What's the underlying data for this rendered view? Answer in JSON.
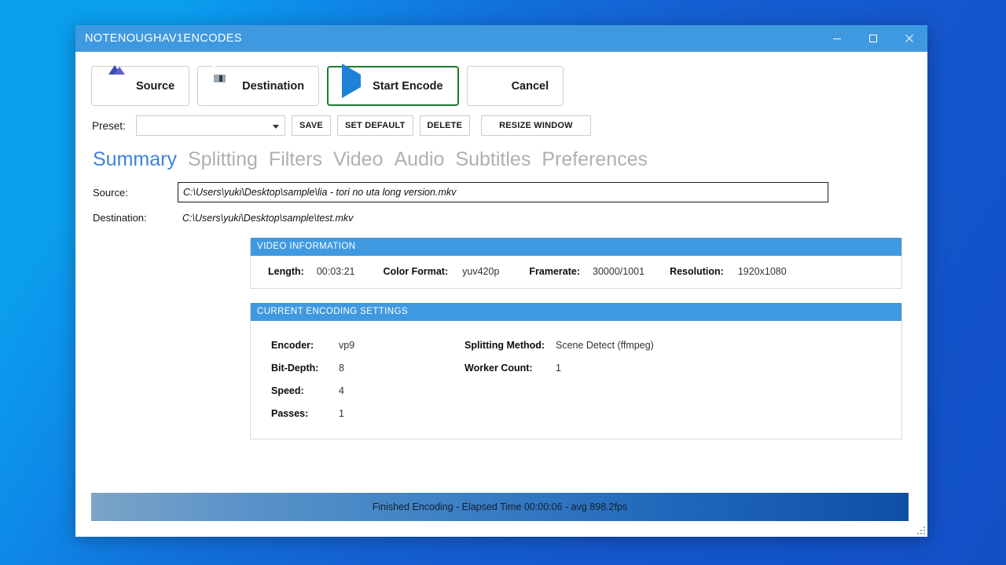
{
  "window": {
    "title": "NOTENOUGHAV1ENCODES",
    "controls": {
      "minimize": "minimize-icon",
      "maximize": "maximize-icon",
      "close": "close-icon"
    }
  },
  "toolbar": {
    "source_label": "Source",
    "destination_label": "Destination",
    "start_encode_label": "Start Encode",
    "cancel_label": "Cancel"
  },
  "preset": {
    "label": "Preset:",
    "value": "",
    "placeholder": "",
    "save_label": "SAVE",
    "set_default_label": "SET DEFAULT",
    "delete_label": "DELETE",
    "resize_window_label": "RESIZE WINDOW"
  },
  "tabs": [
    {
      "label": "Summary",
      "active": true
    },
    {
      "label": "Splitting",
      "active": false
    },
    {
      "label": "Filters",
      "active": false
    },
    {
      "label": "Video",
      "active": false
    },
    {
      "label": "Audio",
      "active": false
    },
    {
      "label": "Subtitles",
      "active": false
    },
    {
      "label": "Preferences",
      "active": false
    }
  ],
  "summary": {
    "source_label": "Source:",
    "source_value": "C:\\Users\\yuki\\Desktop\\sample\\lia - tori no uta long version.mkv",
    "destination_label": "Destination:",
    "destination_value": "C:\\Users\\yuki\\Desktop\\sample\\test.mkv"
  },
  "video_information": {
    "header": "VIDEO INFORMATION",
    "fields": [
      {
        "key": "Length:",
        "value": "00:03:21"
      },
      {
        "key": "Color Format:",
        "value": "yuv420p"
      },
      {
        "key": "Framerate:",
        "value": "30000/1001"
      },
      {
        "key": "Resolution:",
        "value": "1920x1080"
      }
    ]
  },
  "encoding_settings": {
    "header": "CURRENT ENCODING SETTINGS",
    "left_column": [
      {
        "key": "Encoder:",
        "value": "vp9"
      },
      {
        "key": "Bit-Depth:",
        "value": "8"
      },
      {
        "key": "Speed:",
        "value": "4"
      },
      {
        "key": "Passes:",
        "value": "1"
      }
    ],
    "right_column": [
      {
        "key": "Splitting Method:",
        "value": "Scene Detect (ffmpeg)"
      },
      {
        "key": "Worker  Count:",
        "value": "1"
      }
    ]
  },
  "status": {
    "progress_text": "Finished Encoding - Elapsed Time 00:00:06 - avg 898.2fps"
  },
  "colors": {
    "titlebar": "#3f99e0",
    "panel_header": "#3f99e0",
    "active_tab": "#3c83d8",
    "inactive_tab": "#b0b0b0",
    "focus_border": "#1c7c2e",
    "cancel_red": "#e02b2b",
    "play_blue": "#1f81d6",
    "desktop_blue": "#0b9dee"
  }
}
